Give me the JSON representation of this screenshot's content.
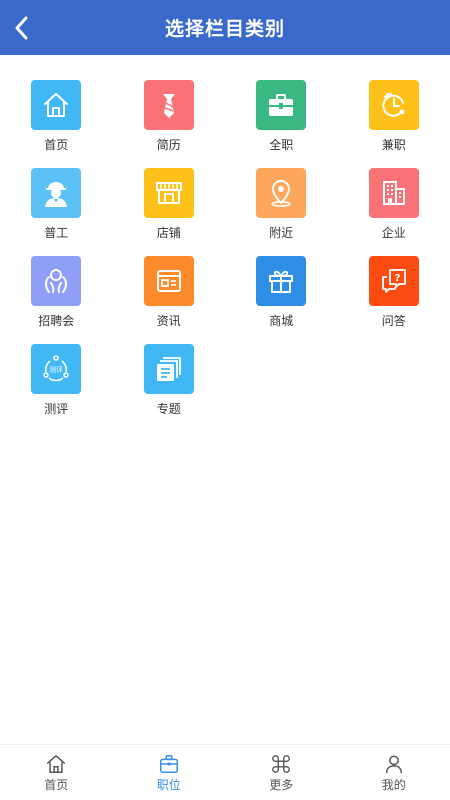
{
  "header": {
    "title": "选择栏目类别",
    "back_icon": "chevron-left-icon"
  },
  "categories": [
    {
      "label": "首页",
      "color": "#41b8f3",
      "icon": "home-icon"
    },
    {
      "label": "简历",
      "color": "#f97276",
      "icon": "tie-icon"
    },
    {
      "label": "全职",
      "color": "#3ab882",
      "icon": "briefcase-icon"
    },
    {
      "label": "兼职",
      "color": "#fec11a",
      "icon": "clock-icon"
    },
    {
      "label": "普工",
      "color": "#5cc2f5",
      "icon": "worker-icon"
    },
    {
      "label": "店铺",
      "color": "#fec11a",
      "icon": "shop-icon"
    },
    {
      "label": "附近",
      "color": "#fda75d",
      "icon": "location-pin-icon"
    },
    {
      "label": "企业",
      "color": "#f97276",
      "icon": "building-icon"
    },
    {
      "label": "招聘会",
      "color": "#8f9ff7",
      "icon": "handshake-icon"
    },
    {
      "label": "资讯",
      "color": "#fd8b2b",
      "icon": "news-icon"
    },
    {
      "label": "商城",
      "color": "#2e8ee6",
      "icon": "gift-icon"
    },
    {
      "label": "问答",
      "color": "#fc4c11",
      "icon": "question-chat-icon"
    },
    {
      "label": "测评",
      "color": "#41b8f3",
      "icon": "evaluation-icon",
      "icon_text": "测评"
    },
    {
      "label": "专题",
      "color": "#41b8f3",
      "icon": "document-stack-icon"
    }
  ],
  "tabbar": {
    "items": [
      {
        "label": "首页",
        "icon": "home-icon",
        "active": false
      },
      {
        "label": "职位",
        "icon": "briefcase-icon",
        "active": true
      },
      {
        "label": "更多",
        "icon": "command-icon",
        "active": false
      },
      {
        "label": "我的",
        "icon": "user-icon",
        "active": false
      }
    ],
    "active_color": "#3a8ee6",
    "inactive_color": "#555555"
  },
  "colors": {
    "header_bg": "#3a69cc",
    "page_bg": "#ffffff"
  }
}
